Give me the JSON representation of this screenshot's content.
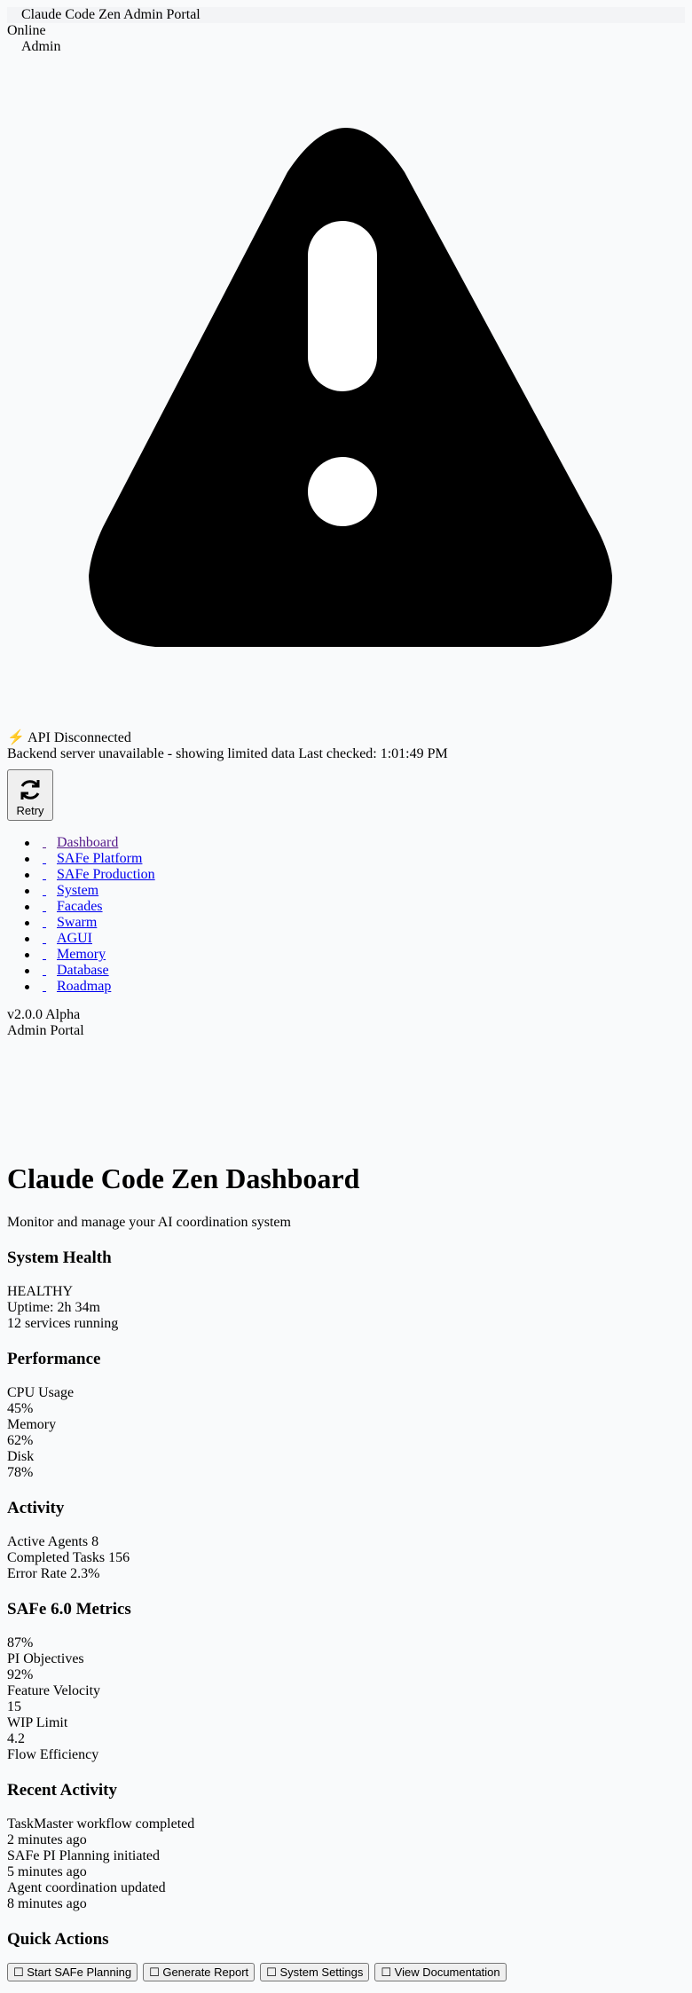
{
  "header": {
    "title": "Claude Code Zen Admin Portal",
    "status": "Online",
    "user": "Admin"
  },
  "api_status": {
    "title": "⚡ API Disconnected",
    "message": "Backend server unavailable - showing limited data Last checked: 1:01:49 PM",
    "retry_label": "Retry"
  },
  "nav": {
    "items": [
      {
        "label": "Dashboard"
      },
      {
        "label": "SAFe Platform"
      },
      {
        "label": "SAFe Production"
      },
      {
        "label": "System"
      },
      {
        "label": "Facades"
      },
      {
        "label": "Swarm"
      },
      {
        "label": "AGUI"
      },
      {
        "label": "Memory"
      },
      {
        "label": "Database"
      },
      {
        "label": "Roadmap"
      }
    ]
  },
  "footer_info": {
    "version": "v2.0.0 Alpha",
    "portal": "Admin Portal"
  },
  "main": {
    "title": "Claude Code Zen Dashboard",
    "subtitle": "Monitor and manage your AI coordination system"
  },
  "system_health": {
    "heading": "System Health",
    "status": "HEALTHY",
    "uptime": "Uptime: 2h 34m",
    "services": "12 services running"
  },
  "performance": {
    "heading": "Performance",
    "metrics": [
      {
        "label": "CPU Usage",
        "value": "45%"
      },
      {
        "label": "Memory",
        "value": "62%"
      },
      {
        "label": "Disk",
        "value": "78%"
      }
    ]
  },
  "activity": {
    "heading": "Activity",
    "items": [
      {
        "text": "Active Agents 8"
      },
      {
        "text": "Completed Tasks 156"
      },
      {
        "text": "Error Rate 2.3%"
      }
    ]
  },
  "safe_metrics": {
    "heading": "SAFe 6.0 Metrics",
    "items": [
      {
        "value": "87%",
        "label": "PI Objectives"
      },
      {
        "value": "92%",
        "label": "Feature Velocity"
      },
      {
        "value": "15",
        "label": "WIP Limit"
      },
      {
        "value": "4.2",
        "label": "Flow Efficiency"
      }
    ]
  },
  "recent_activity": {
    "heading": "Recent Activity",
    "items": [
      {
        "text": "TaskMaster workflow completed",
        "time": "2 minutes ago"
      },
      {
        "text": "SAFe PI Planning initiated",
        "time": "5 minutes ago"
      },
      {
        "text": "Agent coordination updated",
        "time": "8 minutes ago"
      }
    ]
  },
  "quick_actions": {
    "heading": "Quick Actions",
    "buttons": [
      {
        "label": "☐ Start SAFe Planning"
      },
      {
        "label": "☐ Generate Report"
      },
      {
        "label": "☐ System Settings"
      },
      {
        "label": "☐ View Documentation"
      }
    ]
  }
}
